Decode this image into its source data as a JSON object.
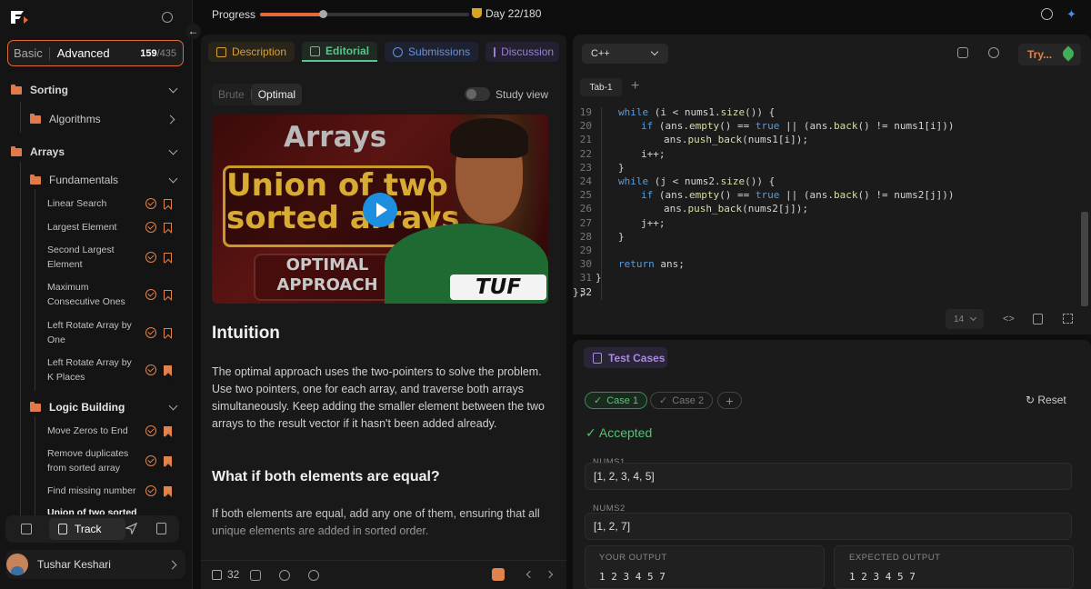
{
  "sidebar": {
    "tabs": {
      "basic": "Basic",
      "advanced": "Advanced"
    },
    "count": {
      "done": "159",
      "total": "/435"
    },
    "groups": [
      {
        "label": "Sorting"
      },
      {
        "label": "Algorithms"
      },
      {
        "label": "Arrays"
      },
      {
        "label": "Fundamentals"
      },
      {
        "label": "Logic Building"
      }
    ],
    "problems": [
      {
        "label": "Linear Search"
      },
      {
        "label": "Largest Element"
      },
      {
        "label": "Second Largest Element"
      },
      {
        "label": "Maximum Consecutive Ones"
      },
      {
        "label": "Left Rotate Array by One"
      },
      {
        "label": "Left Rotate Array by K Places"
      },
      {
        "label": "Move Zeros to End"
      },
      {
        "label": "Remove duplicates from sorted array"
      },
      {
        "label": "Find missing number"
      },
      {
        "label": "Union of two sorted"
      }
    ],
    "bottom_nav": {
      "track": "Track"
    },
    "user": {
      "name": "Tushar Keshari"
    }
  },
  "topbar": {
    "progress_label": "Progress",
    "progress_fraction": 0.3,
    "day": "Day 22/180"
  },
  "description": {
    "tabs": [
      "Description",
      "Editorial",
      "Submissions",
      "Discussion"
    ],
    "approach": {
      "brute": "Brute",
      "optimal": "Optimal"
    },
    "study_view": "Study view",
    "thumbnail": {
      "title": "Arrays",
      "headline_1": "Union of two",
      "headline_2": "sorted arrays",
      "badge_1": "OPTIMAL",
      "badge_2": "APPROACH",
      "brand": "TUF"
    },
    "heading": "Intuition",
    "paragraph": "The optimal approach uses the two-pointers to solve the problem. Use two pointers, one for each array, and traverse both arrays simultaneously. Keep adding the smaller element between the two arrays to the result vector if it hasn't been added already.",
    "subheading": "What if both elements are equal?",
    "paragraph2": "If both elements are equal, add any one of them, ensuring that all unique elements are added in sorted order.",
    "likes": "32"
  },
  "editor": {
    "language": "C++",
    "try_button": "Try...",
    "file_tab": "Tab-1",
    "font_size": "14",
    "line_numbers": [
      "19",
      "20",
      "21",
      "22",
      "23",
      "24",
      "25",
      "26",
      "27",
      "28",
      "29",
      "30",
      "31",
      "32"
    ],
    "code_lines": [
      "while (i < nums1.size()) {",
      "    if (ans.empty() == true || (ans.back() != nums1[i]))",
      "        ans.push_back(nums1[i]);",
      "    i++;",
      "}",
      "while (j < nums2.size()) {",
      "    if (ans.empty() == true || (ans.back() != nums2[j]))",
      "        ans.push_back(nums2[j]);",
      "    j++;",
      "}",
      "",
      "return ans;",
      "}",
      "};"
    ]
  },
  "tests": {
    "tab": "Test Cases",
    "cases": [
      "Case 1",
      "Case 2"
    ],
    "reset": "Reset",
    "status": "Accepted",
    "nums1_label": "NUMS1",
    "nums1": "[1, 2, 3, 4, 5]",
    "nums2_label": "NUMS2",
    "nums2": "[1, 2, 7]",
    "your_output_label": "YOUR OUTPUT",
    "your_output": "1 2 3 4 5 7",
    "expected_label": "EXPECTED OUTPUT",
    "expected": "1 2 3 4 5 7"
  },
  "colors": {
    "accent": "#e0693e",
    "success": "#4fc470",
    "editorial": "#5ac48a"
  }
}
